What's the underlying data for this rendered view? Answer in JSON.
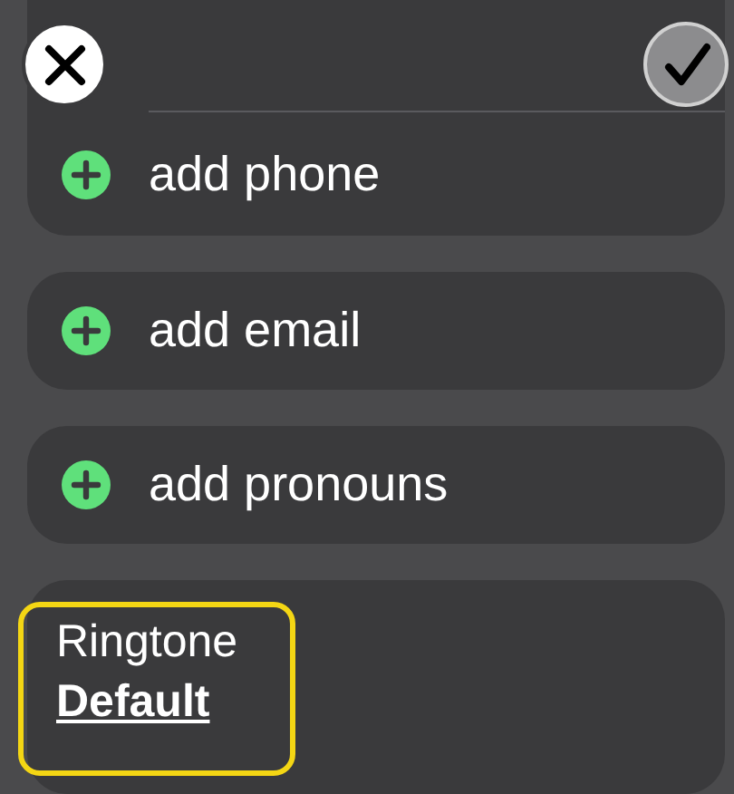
{
  "rows": [
    {
      "label": "add phone"
    },
    {
      "label": "add email"
    },
    {
      "label": "add pronouns"
    }
  ],
  "ringtone": {
    "label": "Ringtone",
    "value": "Default",
    "highlighted": true
  }
}
